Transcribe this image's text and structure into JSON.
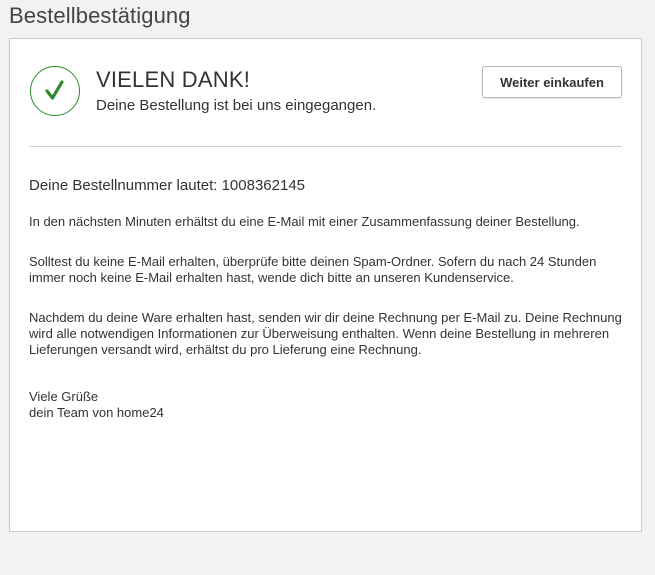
{
  "page": {
    "title": "Bestellbestätigung"
  },
  "confirmation": {
    "heading": "VIELEN DANK!",
    "subheading": "Deine Bestellung ist bei uns eingegangen.",
    "continue_button": "Weiter einkaufen",
    "order_number_text": "Deine Bestellnummer lautet: 1008362145",
    "paragraphs": [
      "In den nächsten Minuten erhältst du eine E-Mail mit einer Zusammenfassung deiner Bestellung.",
      "Solltest du keine E-Mail erhalten, überprüfe bitte deinen Spam-Ordner. Sofern du nach 24 Stunden immer noch keine E-Mail erhalten hast, wende dich bitte an unseren Kundenservice.",
      "Nachdem du deine Ware erhalten hast, senden wir dir deine Rechnung per E-Mail zu. Deine Rechnung wird alle notwendigen Informationen zur Überweisung enthalten. Wenn deine Bestellung in mehreren Lieferungen versandt wird, erhältst du pro Lieferung eine Rechnung."
    ],
    "closing_line1": "Viele Grüße",
    "closing_line2": "dein Team von home24"
  },
  "icons": {
    "success": "checkmark-icon"
  },
  "colors": {
    "success_green": "#2e8b2e",
    "background": "#f2f2f2",
    "card": "#ffffff",
    "text": "#333333"
  }
}
